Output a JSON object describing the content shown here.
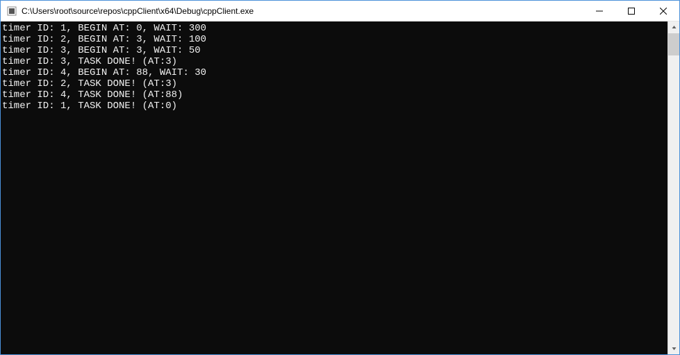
{
  "window": {
    "title": "C:\\Users\\root\\source\\repos\\cppClient\\x64\\Debug\\cppClient.exe"
  },
  "console": {
    "lines": [
      "timer ID: 1, BEGIN AT: 0, WAIT: 300",
      "timer ID: 2, BEGIN AT: 3, WAIT: 100",
      "timer ID: 3, BEGIN AT: 3, WAIT: 50",
      "timer ID: 3, TASK DONE! (AT:3)",
      "timer ID: 4, BEGIN AT: 88, WAIT: 30",
      "timer ID: 2, TASK DONE! (AT:3)",
      "timer ID: 4, TASK DONE! (AT:88)",
      "timer ID: 1, TASK DONE! (AT:0)"
    ]
  }
}
